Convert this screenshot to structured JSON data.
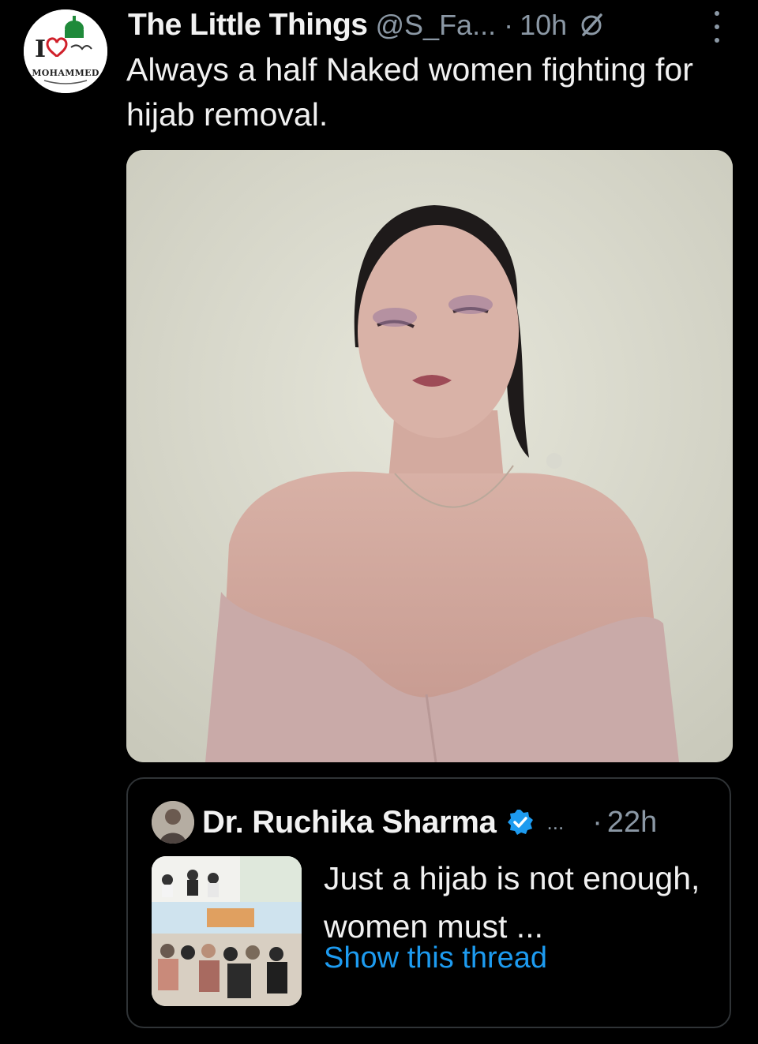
{
  "tweet": {
    "author_name": "The Little Things",
    "handle": "@S_Fa...",
    "separator": "·",
    "time": "10h",
    "text": "Always a half Naked women fighting for hijab removal.",
    "avatar_caption": "MOHAMMED",
    "icons": {
      "grok": "grok-icon",
      "more": "more-vertical-icon"
    }
  },
  "quote": {
    "author_name": "Dr. Ruchika Sharma",
    "ellipsis": "...",
    "separator": "·",
    "time": "22h",
    "text": "Just a hijab is not enough, women must ...",
    "link": "Show this thread",
    "icons": {
      "verified": "verified-badge-icon"
    }
  },
  "colors": {
    "background": "#000000",
    "muted": "#8b98a5",
    "link": "#1d9bf0",
    "border": "#2f3336",
    "verified": "#1d9bf0"
  }
}
